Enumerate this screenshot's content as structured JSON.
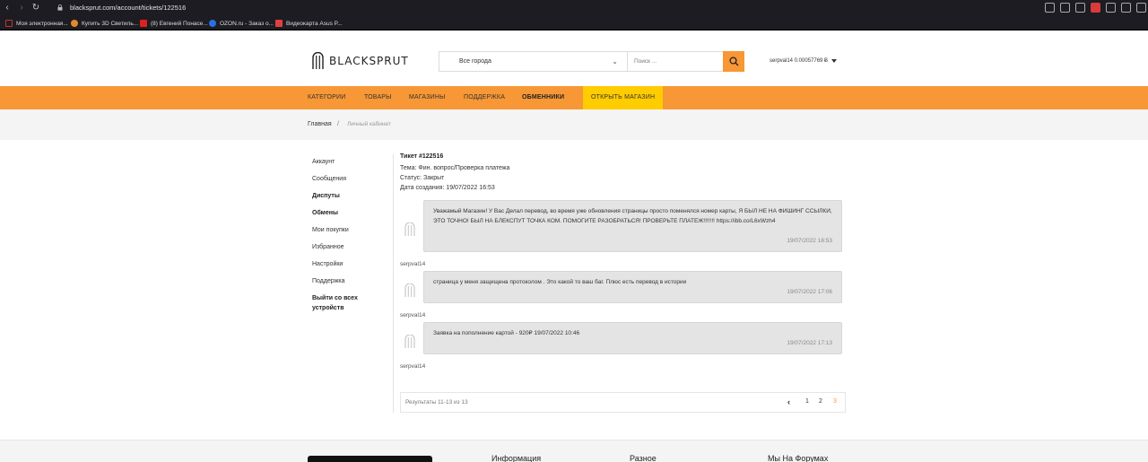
{
  "browser": {
    "url": "blacksprut.com/account/tickets/122516",
    "bookmarks": [
      {
        "label": "Моя электронная...",
        "color": "#c0392b"
      },
      {
        "label": "Купить 3D Светиль...",
        "color": "#e08a2a"
      },
      {
        "label": "(8) Евгений Понасе...",
        "color": "#e02020"
      },
      {
        "label": "OZON.ru - Заказ о...",
        "color": "#2b6fe0"
      },
      {
        "label": "Видеокарта Asus P...",
        "color": "#e04040"
      }
    ]
  },
  "header": {
    "logo_text": "BLACKSPRUT",
    "city_select": "Все города",
    "search_placeholder": "Поиск ...",
    "user_balance": "serpval14 0.00057769 Ƀ"
  },
  "nav": {
    "items": [
      "КАТЕГОРИИ",
      "ТОВАРЫ",
      "МАГАЗИНЫ",
      "ПОДДЕРЖКА",
      "ОБМЕННИКИ",
      "ОТКРЫТЬ МАГАЗИН"
    ]
  },
  "breadcrumb": {
    "home": "Главная",
    "separator": "/",
    "current": "Личный кабинет"
  },
  "sidebar": {
    "items": [
      "Аккаунт",
      "Сообщения",
      "Диспуты",
      "Обмены",
      "Мои покупки",
      "Избранное",
      "Настройки",
      "Поддержка",
      "Выйти со всех устройств"
    ]
  },
  "ticket": {
    "title": "Тикет #122516",
    "topic": "Тема: Фин. вопрос/Проверка платежа",
    "status": "Статус: Закрыт",
    "created": "Дата создания: 19/07/2022 16:53"
  },
  "messages": [
    {
      "text": "Уважамый Магазин! У Вас Делал перевод, во время уже обновления страницы просто поменялся номер карты, Я БЫЛ НЕ НА ФИШИНГ ССЫЛКИ, ЭТО ТОЧНО! БЫЛ НА БЛЕКСПУТ ТОЧКА КОМ. ПОМОГИТЕ РАЗОБРАТЬСЯ! ПРОВЕРЬТЕ ПЛАТЕЖ!!!!!!! https://ibb.co/L6xWzh4",
      "time": "19/07/2022 16:53",
      "author": "serpval14"
    },
    {
      "text": "страница у меня защищена протоколом . Это какой то ваш баг. Плюс есть перевод в истории",
      "time": "19/07/2022 17:06",
      "author": "serpval14"
    },
    {
      "text": "Заявка на пополнение картой - 920₽ 19/07/2022 10:46",
      "time": "19/07/2022 17:13",
      "author": "serpval14"
    }
  ],
  "pagination": {
    "results": "Результаты 11-13 из 13",
    "prev": "‹",
    "pages": [
      "1",
      "2",
      "3"
    ],
    "active_page": "3"
  },
  "footer": {
    "headings": [
      "Информация",
      "Разное",
      "Мы На Форумах"
    ]
  },
  "colors": {
    "accent": "#f79735",
    "open_shop": "#ffcc00",
    "chrome": "#1d1c22"
  }
}
